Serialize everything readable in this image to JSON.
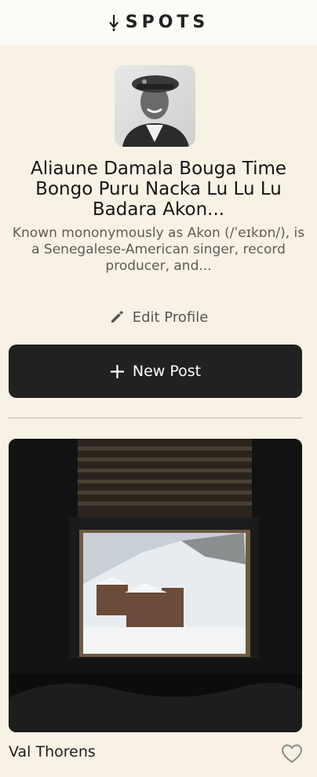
{
  "app": {
    "brand": "SPOTS",
    "brand_icon": "anchor-down-icon"
  },
  "profile": {
    "avatar_icon": "profile-photo",
    "name": "Aliaune Damala Bouga Time Bongo Puru Nacka Lu Lu Lu Badara Akon...",
    "bio": "Known mononymously as Akon (/ˈeɪkɒn/), is a Senegalese-American singer, record producer, and...",
    "edit_label": "Edit Profile",
    "edit_icon": "pencil-icon"
  },
  "actions": {
    "new_post_label": "New Post",
    "new_post_icon": "plus-icon"
  },
  "cards": [
    {
      "title": "Val Thorens",
      "image_icon": "mountain-window-photo",
      "like_icon": "heart-icon",
      "liked": false
    }
  ],
  "colors": {
    "background": "#f8f2e6",
    "header": "#fcfbf8",
    "dark": "#212121",
    "muted": "#5f5b57"
  }
}
